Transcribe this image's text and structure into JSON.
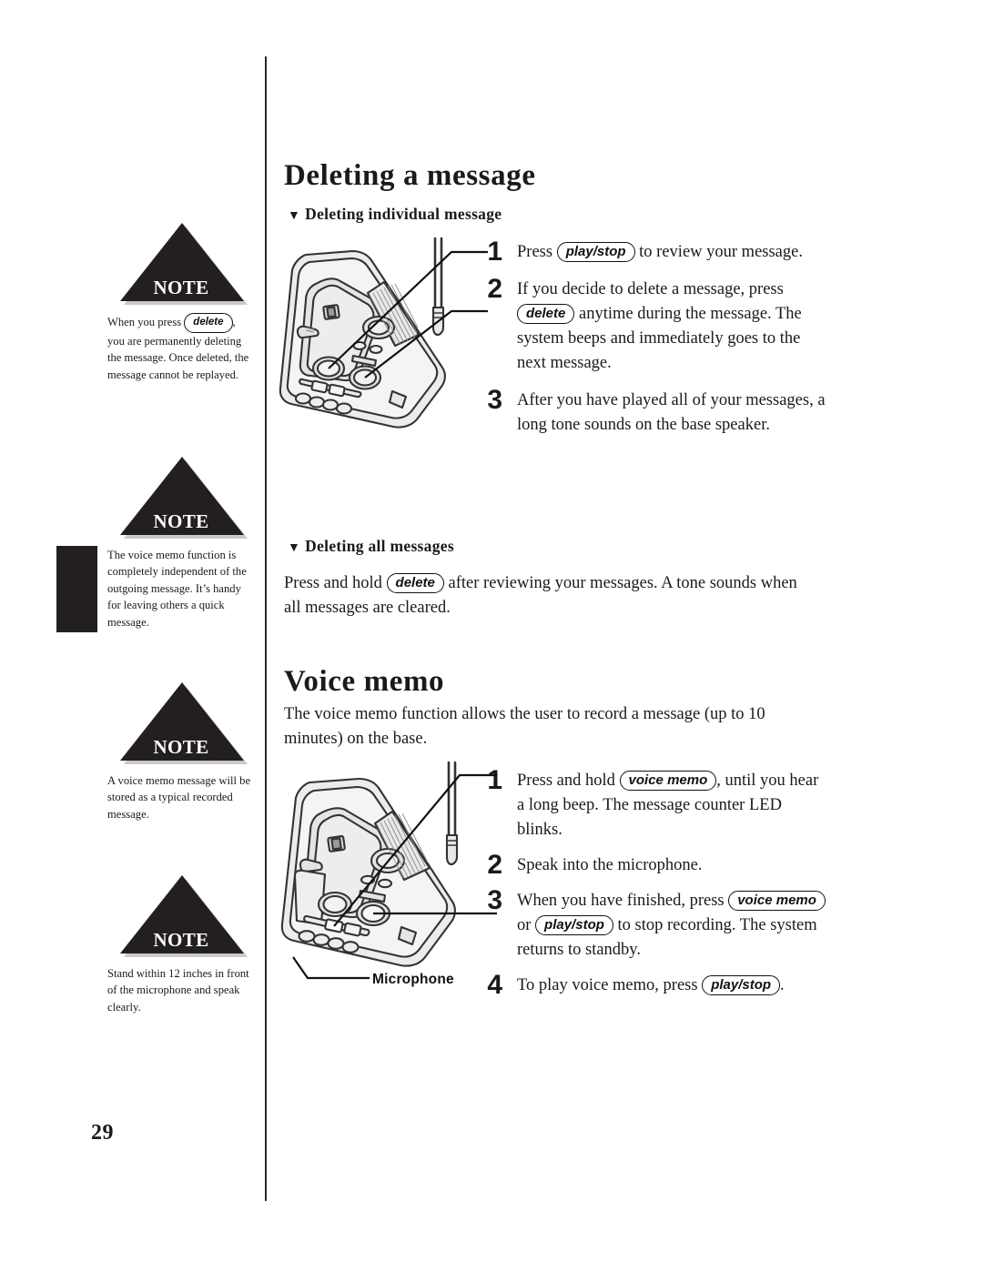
{
  "page": {
    "number": "29",
    "note_badge_label": "NOTE",
    "bullet_glyph": "▼"
  },
  "notes": [
    {
      "id": "note-delete-permanent",
      "badge": "NOTE",
      "text_before": "When you press",
      "pill": "delete",
      "text_after": ", you are permanently deleting the message. Once deleted, the message cannot be replayed."
    },
    {
      "id": "note-voice-memo-independent",
      "badge": "NOTE",
      "text_before": "",
      "pill": "",
      "text_after": "The voice memo function is completely independent of the outgoing message. It’s handy for leaving others a quick message."
    },
    {
      "id": "note-stored-as-typical",
      "badge": "NOTE",
      "text_before": "",
      "pill": "",
      "text_after": "A voice memo message will be stored as a typical recorded message."
    },
    {
      "id": "note-stand-within-12-inches",
      "badge": "NOTE",
      "text_before": "",
      "pill": "",
      "text_after": "Stand within 12 inches in front of the microphone and speak clearly."
    }
  ],
  "sections": {
    "deleting": {
      "heading": "Deleting a message",
      "sub_individual": "Deleting individual message",
      "sub_all": "Deleting all messages",
      "steps": [
        {
          "num": "1",
          "parts": [
            {
              "t": "text",
              "v": "Press "
            },
            {
              "t": "pill",
              "v": "play/stop"
            },
            {
              "t": "text",
              "v": " to review your message."
            }
          ]
        },
        {
          "num": "2",
          "parts": [
            {
              "t": "text",
              "v": "If you decide to delete a message, press "
            },
            {
              "t": "pill",
              "v": "delete"
            },
            {
              "t": "text",
              "v": " anytime during the message. The system beeps and immediately goes to the next message."
            }
          ]
        },
        {
          "num": "3",
          "parts": [
            {
              "t": "text",
              "v": "After you have played all of your messages, a long tone sounds on the base speaker."
            }
          ]
        }
      ],
      "all_messages_paragraph": [
        {
          "t": "text",
          "v": "Press and hold "
        },
        {
          "t": "pill",
          "v": "delete"
        },
        {
          "t": "text",
          "v": " after reviewing your messages. A tone sounds when all messages are cleared."
        }
      ]
    },
    "voice_memo": {
      "heading": "Voice memo",
      "intro": "The voice memo function allows the user to record a message (up to 10 minutes) on the base.",
      "steps": [
        {
          "num": "1",
          "parts": [
            {
              "t": "text",
              "v": "Press and hold "
            },
            {
              "t": "pill",
              "v": "voice memo"
            },
            {
              "t": "text",
              "v": ", until you hear a long beep. The message counter LED blinks."
            }
          ]
        },
        {
          "num": "2",
          "parts": [
            {
              "t": "text",
              "v": "Speak into the microphone."
            }
          ]
        },
        {
          "num": "3",
          "parts": [
            {
              "t": "text",
              "v": "When you have finished, press "
            },
            {
              "t": "pill",
              "v": "voice memo"
            },
            {
              "t": "text",
              "v": " or "
            },
            {
              "t": "pill",
              "v": "play/stop"
            },
            {
              "t": "text",
              "v": " to stop recording. The system returns to standby."
            }
          ]
        },
        {
          "num": "4",
          "parts": [
            {
              "t": "text",
              "v": "To play voice memo, press "
            },
            {
              "t": "pill",
              "v": "play/stop"
            },
            {
              "t": "text",
              "v": "."
            }
          ]
        }
      ]
    }
  },
  "illustrations": {
    "top": {
      "name": "answering-machine-base-diagram",
      "callouts": [
        "1",
        "2"
      ]
    },
    "bottom": {
      "name": "answering-machine-base-microphone-diagram",
      "callouts": [
        "1",
        "3"
      ],
      "microphone_label": "Microphone"
    }
  },
  "colors": {
    "ink": "#1a1a1a",
    "note_fill": "#231f20",
    "rule": "#332233",
    "device_body": "#e9e9e9",
    "device_line": "#333333"
  }
}
